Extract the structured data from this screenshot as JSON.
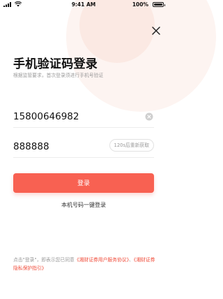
{
  "status_bar": {
    "time": "9:41 AM",
    "battery_percent": "100%",
    "signal_icon": "signal-bars-icon",
    "wifi_icon": "wifi-icon",
    "battery_icon": "battery-icon"
  },
  "header": {
    "close_icon": "close-icon"
  },
  "page": {
    "title": "手机验证码登录",
    "subtitle": "根据监管要求，首次登录须进行手机号验证"
  },
  "form": {
    "phone_value": "15800646982",
    "clear_icon": "clear-circle-icon",
    "code_value": "888888",
    "resend_label": "120s后重新获取"
  },
  "actions": {
    "login_label": "登录",
    "one_click_label": "本机号码一键登录"
  },
  "agreement": {
    "prefix": "点击\"登录\"，即表示您已同意",
    "user_agreement_link": "《湘财证券用户服务协议》",
    "separator": "、",
    "privacy_link": "《湘财证券隐私保护指引》"
  },
  "colors": {
    "accent": "#f86152",
    "link": "#f04d3b",
    "muted_text": "#9a9a9a",
    "decoration": "#fdf4f1"
  }
}
